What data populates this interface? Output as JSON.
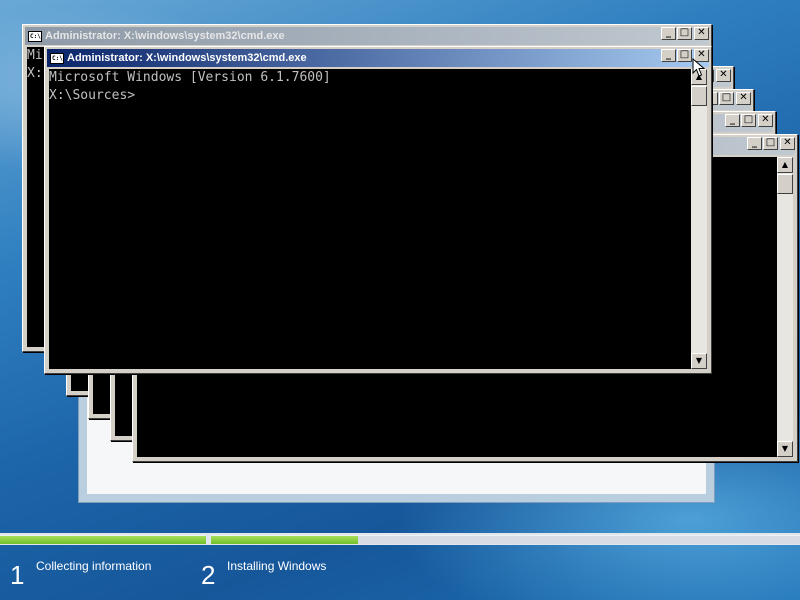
{
  "windows": [
    {
      "title": "Administrator: X:\\windows\\system32\\cmd.exe",
      "lines": [
        "Mi",
        "",
        "X:"
      ]
    },
    {
      "title": "",
      "lines": []
    },
    {
      "title": "",
      "lines": []
    },
    {
      "title": "",
      "lines": []
    },
    {
      "title": "",
      "lines": []
    },
    {
      "title": "Administrator: X:\\windows\\system32\\cmd.exe",
      "lines": [
        "Microsoft Windows [Version 6.1.7600]",
        "",
        "X:\\Sources>"
      ]
    }
  ],
  "controls": {
    "minimize": "_",
    "maximize": "□",
    "close": "✕",
    "scroll_up": "▲",
    "scroll_down": "▼",
    "app_icon": "C:\\"
  },
  "setup": {
    "steps": [
      {
        "number": "1",
        "label": "Collecting information"
      },
      {
        "number": "2",
        "label": "Installing Windows"
      }
    ],
    "progress": [
      1.0,
      0.25
    ]
  },
  "colors": {
    "active_title": "#0a246a",
    "progress_fill": "#6fbf2a",
    "console_bg": "#000000"
  },
  "icons": {
    "cursor": "mouse-pointer-icon",
    "window": "cmd-window-icon"
  }
}
